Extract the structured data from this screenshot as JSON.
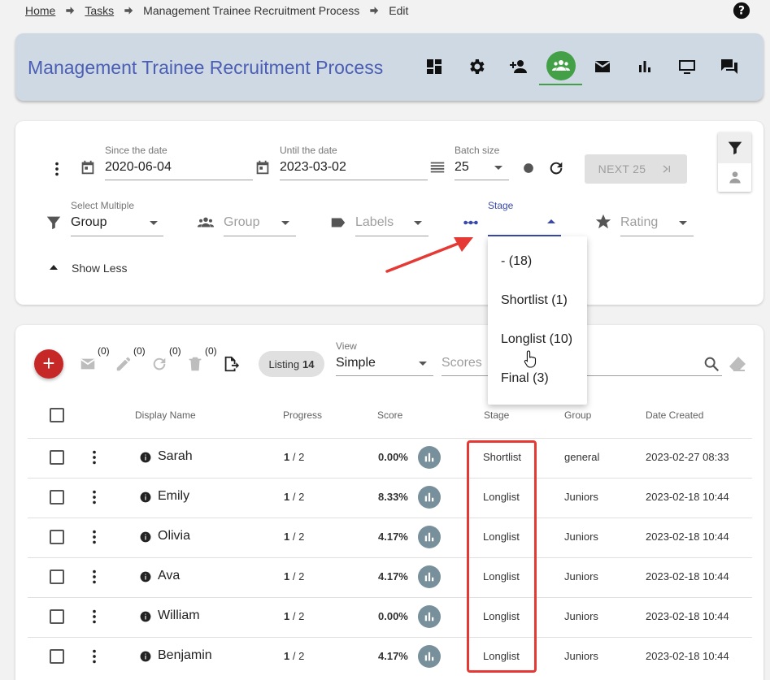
{
  "breadcrumb": {
    "home": "Home",
    "tasks": "Tasks",
    "current": "Management Trainee Recruitment Process",
    "edit": "Edit"
  },
  "header": {
    "title": "Management Trainee Recruitment Process"
  },
  "filters": {
    "since_label": "Since the date",
    "since_value": "2020-06-04",
    "until_label": "Until the date",
    "until_value": "2023-03-02",
    "batch_label": "Batch size",
    "batch_value": "25",
    "next_label": "NEXT 25",
    "group_multi_label": "Select Multiple",
    "group_multi_value": "Group",
    "group_placeholder": "Group",
    "labels_placeholder": "Labels",
    "stage_label": "Stage",
    "rating_placeholder": "Rating",
    "show_less": "Show Less"
  },
  "stage_dropdown": [
    "- (18)",
    "Shortlist (1)",
    "Longlist (10)",
    "Final (3)"
  ],
  "toolbar": {
    "add": "+",
    "email_count": "(0)",
    "edit_count": "(0)",
    "refresh_count": "(0)",
    "delete_count": "(0)",
    "listing_label": "Listing",
    "listing_count": "14",
    "view_label": "View",
    "view_value": "Simple",
    "scores_placeholder": "Scores"
  },
  "table": {
    "headers": {
      "name": "Display Name",
      "progress": "Progress",
      "score": "Score",
      "stage": "Stage",
      "group": "Group",
      "date": "Date Created"
    },
    "rows": [
      {
        "name": "Sarah",
        "progress_done": "1",
        "progress_total": " / 2",
        "score": "0.00%",
        "stage": "Shortlist",
        "group": "general",
        "date": "2023-02-27 08:33"
      },
      {
        "name": "Emily",
        "progress_done": "1",
        "progress_total": " / 2",
        "score": "8.33%",
        "stage": "Longlist",
        "group": "Juniors",
        "date": "2023-02-18 10:44"
      },
      {
        "name": "Olivia",
        "progress_done": "1",
        "progress_total": " / 2",
        "score": "4.17%",
        "stage": "Longlist",
        "group": "Juniors",
        "date": "2023-02-18 10:44"
      },
      {
        "name": "Ava",
        "progress_done": "1",
        "progress_total": " / 2",
        "score": "4.17%",
        "stage": "Longlist",
        "group": "Juniors",
        "date": "2023-02-18 10:44"
      },
      {
        "name": "William",
        "progress_done": "1",
        "progress_total": " / 2",
        "score": "0.00%",
        "stage": "Longlist",
        "group": "Juniors",
        "date": "2023-02-18 10:44"
      },
      {
        "name": "Benjamin",
        "progress_done": "1",
        "progress_total": " / 2",
        "score": "4.17%",
        "stage": "Longlist",
        "group": "Juniors",
        "date": "2023-02-18 10:44"
      }
    ]
  },
  "colors": {
    "accent": "#4a5eb5",
    "active": "#43a047",
    "fab": "#c62828",
    "highlight": "#e53935",
    "header_bg": "#cfd9e3"
  }
}
